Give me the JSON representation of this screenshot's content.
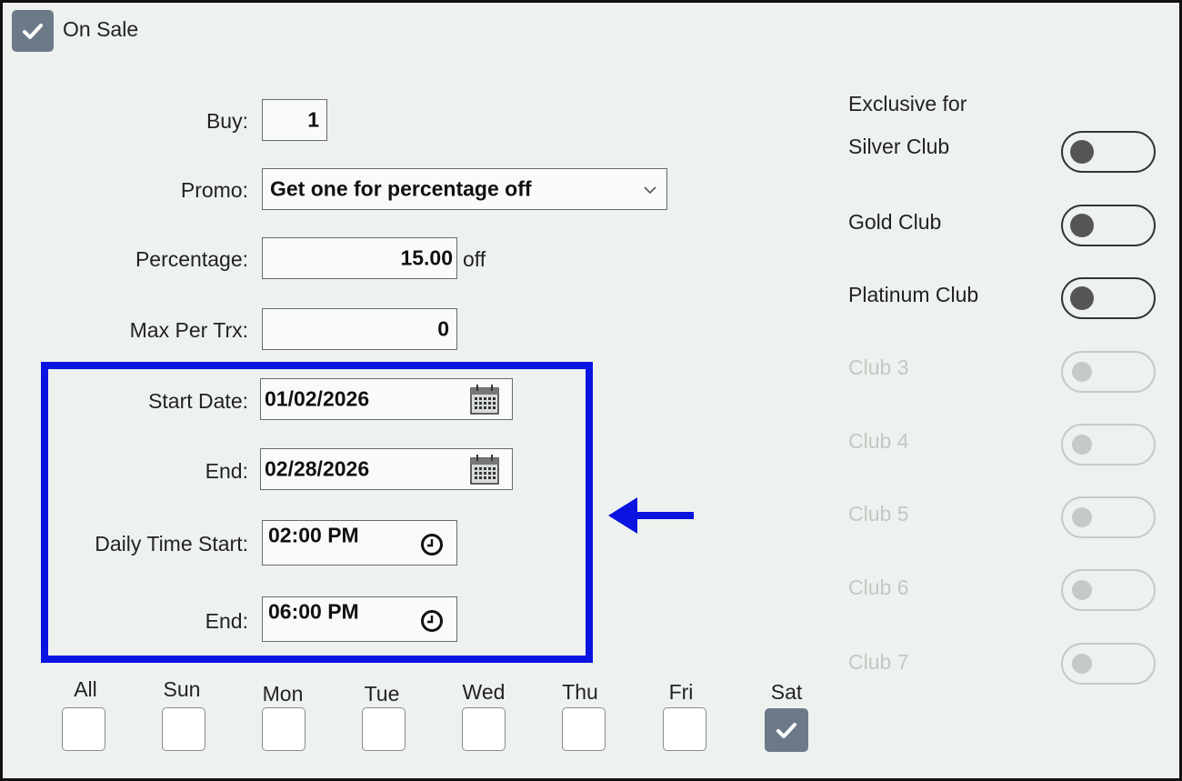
{
  "on_sale": {
    "label": "On Sale",
    "checked": true
  },
  "form": {
    "buy": {
      "label": "Buy:",
      "value": "1"
    },
    "promo": {
      "label": "Promo:",
      "value": "Get one for percentage off"
    },
    "percentage": {
      "label": "Percentage:",
      "value": "15.00",
      "suffix": "off"
    },
    "max_per_trx": {
      "label": "Max Per Trx:",
      "value": "0"
    },
    "start_date": {
      "label": "Start Date:",
      "value": "01/02/2026"
    },
    "end_date": {
      "label": "End:",
      "value": "02/28/2026"
    },
    "daily_time_start": {
      "label": "Daily Time Start:",
      "value": "02:00 PM"
    },
    "daily_time_end": {
      "label": "End:",
      "value": "06:00 PM"
    }
  },
  "days": [
    {
      "label": "All",
      "checked": false
    },
    {
      "label": "Sun",
      "checked": false
    },
    {
      "label": "Mon",
      "checked": false
    },
    {
      "label": "Tue",
      "checked": false
    },
    {
      "label": "Wed",
      "checked": false
    },
    {
      "label": "Thu",
      "checked": false
    },
    {
      "label": "Fri",
      "checked": false
    },
    {
      "label": "Sat",
      "checked": true
    }
  ],
  "exclusive": {
    "heading": "Exclusive for",
    "clubs": [
      {
        "name": "Silver Club",
        "enabled": true,
        "on": false
      },
      {
        "name": "Gold Club",
        "enabled": true,
        "on": false
      },
      {
        "name": "Platinum Club",
        "enabled": true,
        "on": false
      },
      {
        "name": "Club 3",
        "enabled": false,
        "on": false
      },
      {
        "name": "Club 4",
        "enabled": false,
        "on": false
      },
      {
        "name": "Club 5",
        "enabled": false,
        "on": false
      },
      {
        "name": "Club 6",
        "enabled": false,
        "on": false
      },
      {
        "name": "Club 7",
        "enabled": false,
        "on": false
      }
    ]
  },
  "annotation": {
    "highlight_color": "#0a14e0",
    "arrow_direction": "left"
  },
  "icons": {
    "check": "check-icon",
    "dropdown": "chevron-down-icon",
    "calendar": "calendar-icon",
    "clock": "clock-icon"
  }
}
